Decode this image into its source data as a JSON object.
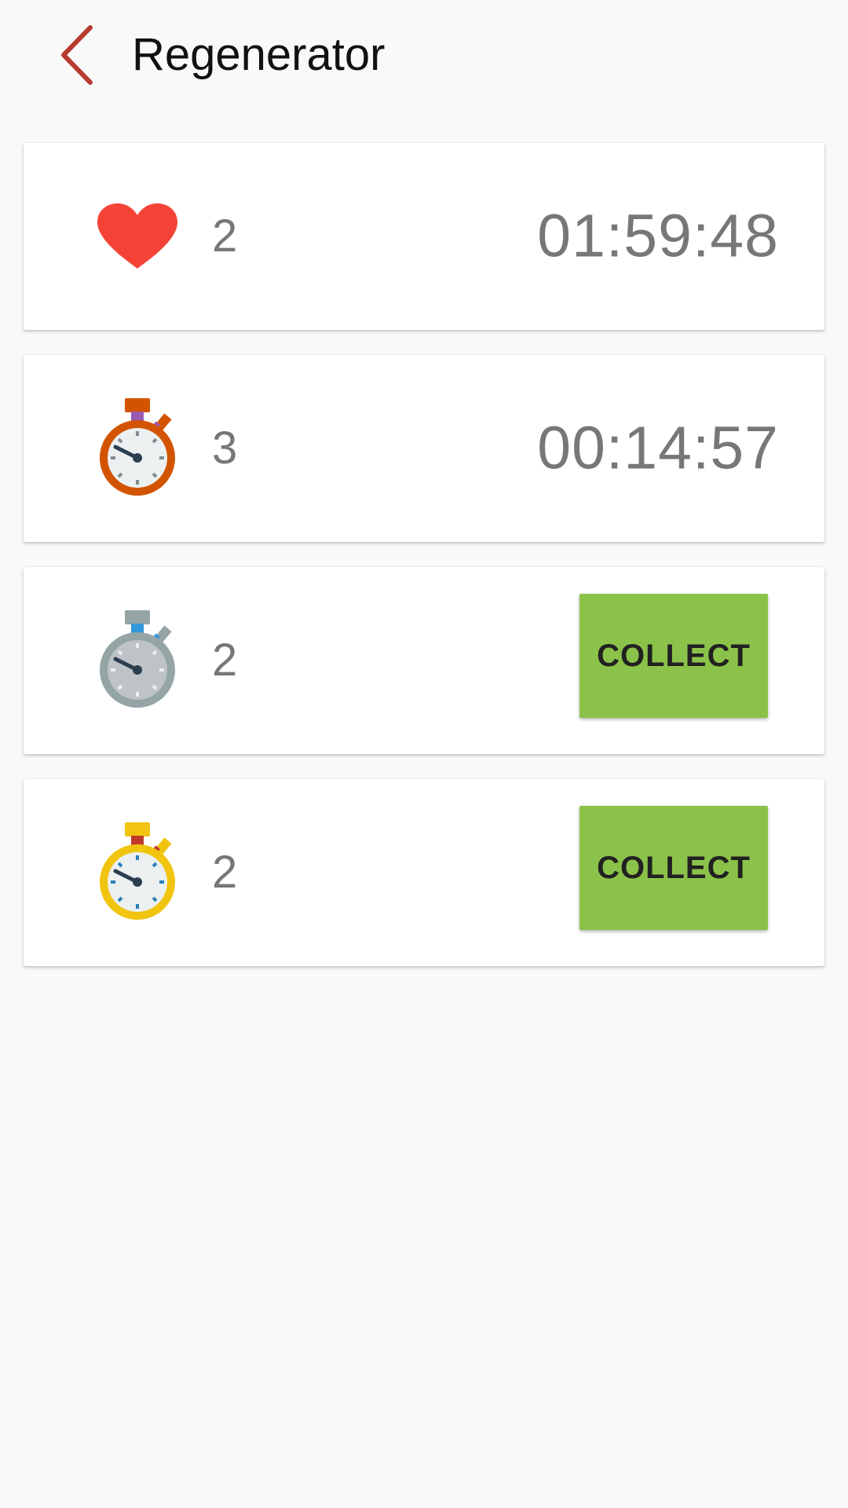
{
  "header": {
    "title": "Regenerator",
    "back_icon": "chevron-left-icon",
    "accent_color": "#b73b2f"
  },
  "items": [
    {
      "icon": "heart-icon",
      "icon_color": "#f44336",
      "count": "2",
      "timer": "01:59:48"
    },
    {
      "icon": "stopwatch-orange-icon",
      "icon_color": "#d35400",
      "count": "3",
      "timer": "00:14:57"
    },
    {
      "icon": "stopwatch-silver-icon",
      "icon_color": "#95a5a6",
      "count": "2",
      "action_label": "COLLECT"
    },
    {
      "icon": "stopwatch-gold-icon",
      "icon_color": "#f1c40f",
      "count": "2",
      "action_label": "COLLECT"
    }
  ],
  "colors": {
    "background": "#f9f9f9",
    "card": "#ffffff",
    "collect_button": "#8bc34a",
    "muted_text": "#777777"
  }
}
